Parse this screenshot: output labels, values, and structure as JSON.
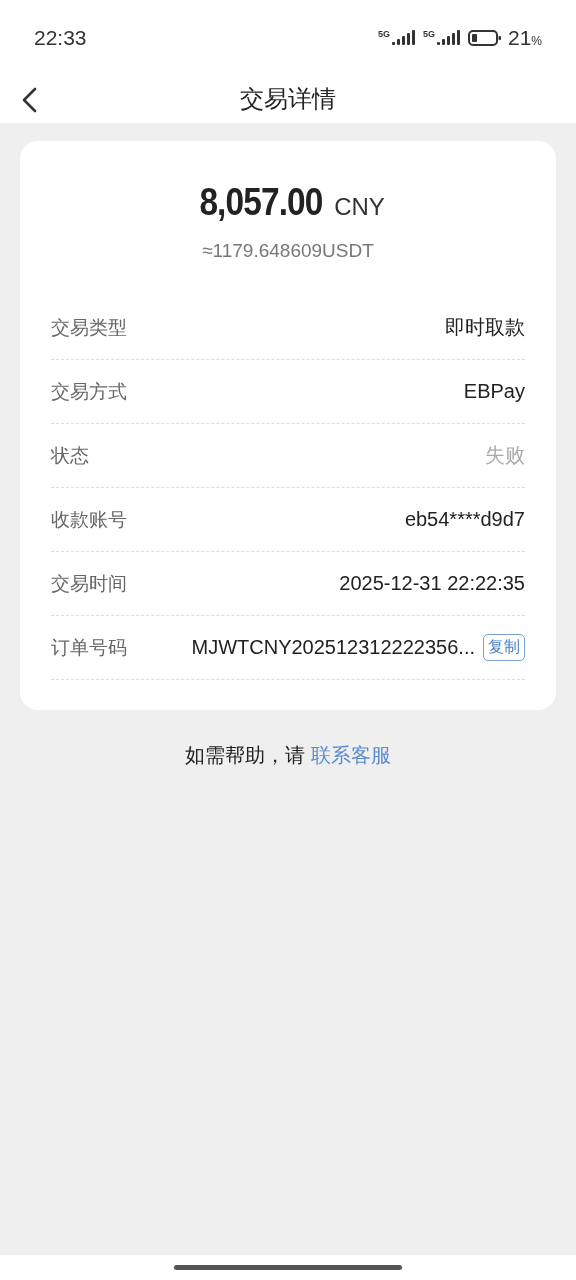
{
  "status_bar": {
    "time": "22:33",
    "network_1": "5G",
    "network_2": "5G",
    "battery": "21",
    "battery_unit": "%"
  },
  "nav": {
    "title": "交易详情"
  },
  "amount": {
    "value": "8,057.00",
    "currency": "CNY",
    "converted": "≈1179.648609USDT"
  },
  "rows": [
    {
      "kind": "plain",
      "label": "交易类型",
      "value": "即时取款"
    },
    {
      "kind": "plain",
      "label": "交易方式",
      "value": "EBPay"
    },
    {
      "kind": "faded",
      "label": "状态",
      "value": "失败"
    },
    {
      "kind": "plain",
      "label": "收款账号",
      "value": "eb54****d9d7"
    },
    {
      "kind": "plain",
      "label": "交易时间",
      "value": "2025-12-31 22:22:35"
    },
    {
      "kind": "copy",
      "label": "订单号码",
      "value": "MJWTCNY202512312222356...",
      "button": "复制"
    }
  ],
  "help": {
    "text": "如需帮助，请 ",
    "link": "联系客服"
  }
}
